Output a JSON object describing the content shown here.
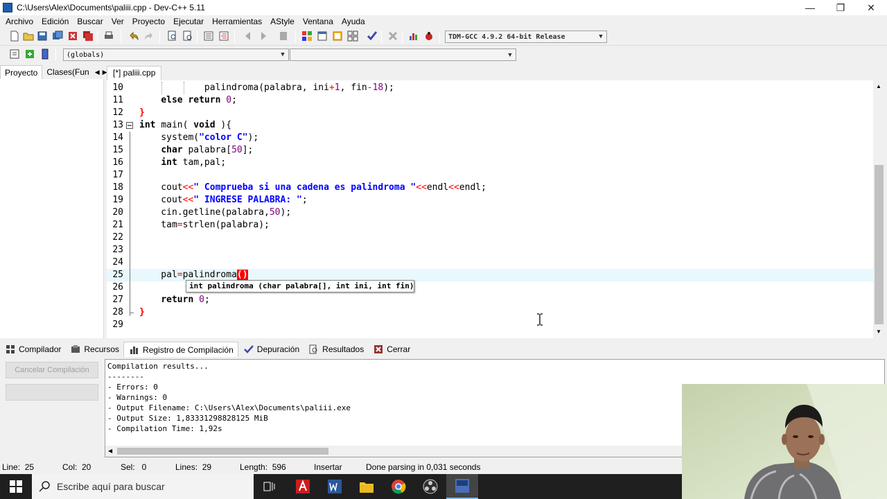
{
  "window": {
    "title": "C:\\Users\\Alex\\Documents\\paliii.cpp - Dev-C++ 5.11",
    "minimize": "—",
    "restore": "❐",
    "close": "✕"
  },
  "menu": [
    "Archivo",
    "Edición",
    "Buscar",
    "Ver",
    "Proyecto",
    "Ejecutar",
    "Herramientas",
    "AStyle",
    "Ventana",
    "Ayuda"
  ],
  "toolbar": {
    "compiler": "TDM-GCC 4.9.2 64-bit Release",
    "scope": "(globals)",
    "function": ""
  },
  "left_tabs": [
    "Proyecto",
    "Clases(Fun"
  ],
  "editor_tab": "[*] paliii.cpp",
  "code_lines": [
    {
      "n": "10",
      "fold": "",
      "segs": [
        [
          "",
          "            "
        ],
        [
          "kw",
          ""
        ],
        [
          "",
          "palindroma(palabra, ini"
        ],
        [
          "op",
          "+"
        ],
        [
          "num",
          "1"
        ],
        [
          "",
          ", fin"
        ],
        [
          "op",
          "-"
        ],
        [
          "num",
          "18"
        ],
        [
          "",
          ");"
        ]
      ]
    },
    {
      "n": "11",
      "fold": "",
      "segs": [
        [
          "",
          "    "
        ],
        [
          "kw",
          "else return "
        ],
        [
          "num",
          "0"
        ],
        [
          "",
          ";"
        ]
      ]
    },
    {
      "n": "12",
      "fold": "",
      "segs": [
        [
          "br",
          "}"
        ]
      ]
    },
    {
      "n": "13",
      "fold": "minus",
      "segs": [
        [
          "kw",
          "int "
        ],
        [
          "",
          "main( "
        ],
        [
          "kw",
          "void "
        ],
        [
          "",
          "){"
        ]
      ]
    },
    {
      "n": "14",
      "fold": "",
      "segs": [
        [
          "",
          "    system("
        ],
        [
          "str",
          "\"color C\""
        ],
        [
          "",
          ");"
        ]
      ]
    },
    {
      "n": "15",
      "fold": "",
      "segs": [
        [
          "",
          "    "
        ],
        [
          "kw",
          "char "
        ],
        [
          "",
          "palabra["
        ],
        [
          "num",
          "50"
        ],
        [
          "",
          "];"
        ]
      ]
    },
    {
      "n": "16",
      "fold": "",
      "segs": [
        [
          "",
          "    "
        ],
        [
          "kw",
          "int "
        ],
        [
          "",
          "tam,pal;"
        ]
      ]
    },
    {
      "n": "17",
      "fold": "",
      "segs": [
        [
          "",
          ""
        ]
      ]
    },
    {
      "n": "18",
      "fold": "",
      "segs": [
        [
          "",
          "    cout"
        ],
        [
          "op",
          "<<"
        ],
        [
          "str",
          "\" Comprueba si una cadena es palindroma \""
        ],
        [
          "op",
          "<<"
        ],
        [
          "",
          "endl"
        ],
        [
          "op",
          "<<"
        ],
        [
          "",
          "endl;"
        ]
      ]
    },
    {
      "n": "19",
      "fold": "",
      "segs": [
        [
          "",
          "    cout"
        ],
        [
          "op",
          "<<"
        ],
        [
          "str",
          "\" INGRESE PALABRA: \""
        ],
        [
          "",
          ";"
        ]
      ]
    },
    {
      "n": "20",
      "fold": "",
      "segs": [
        [
          "",
          "    cin.getline(palabra,"
        ],
        [
          "num",
          "50"
        ],
        [
          "",
          ");"
        ]
      ]
    },
    {
      "n": "21",
      "fold": "",
      "segs": [
        [
          "",
          "    tam"
        ],
        [
          "op",
          "="
        ],
        [
          "",
          "strlen(palabra);"
        ]
      ]
    },
    {
      "n": "22",
      "fold": "",
      "segs": [
        [
          "",
          ""
        ]
      ]
    },
    {
      "n": "23",
      "fold": "",
      "segs": [
        [
          "",
          ""
        ]
      ]
    },
    {
      "n": "24",
      "fold": "",
      "segs": [
        [
          "",
          ""
        ]
      ]
    },
    {
      "n": "25",
      "fold": "",
      "segs": [
        [
          "",
          "    pal"
        ],
        [
          "op",
          "="
        ],
        [
          "",
          "palindroma"
        ],
        [
          "bracematch",
          "()"
        ]
      ]
    },
    {
      "n": "26",
      "fold": "",
      "segs": [
        [
          "",
          ""
        ]
      ]
    },
    {
      "n": "27",
      "fold": "",
      "segs": [
        [
          "",
          "    "
        ],
        [
          "kw",
          "return "
        ],
        [
          "num",
          "0"
        ],
        [
          "",
          ";"
        ]
      ]
    },
    {
      "n": "28",
      "fold": "",
      "segs": [
        [
          "br",
          "}"
        ]
      ]
    },
    {
      "n": "29",
      "fold": "",
      "segs": [
        [
          "",
          ""
        ]
      ]
    }
  ],
  "tooltip": {
    "ret": "int palindroma ",
    "params": "(char palabra[], int ini, int fin)"
  },
  "bottom_tabs": [
    "Compilador",
    "Recursos",
    "Registro de Compilación",
    "Depuración",
    "Resultados",
    "Cerrar"
  ],
  "bottom_buttons": {
    "cancel": "Cancelar Compilación",
    "blank": ""
  },
  "output_lines": [
    "Compilation results...",
    "--------",
    "- Errors: 0",
    "- Warnings: 0",
    "- Output Filename: C:\\Users\\Alex\\Documents\\paliii.exe",
    "- Output Size: 1,83331298828125 MiB",
    "- Compilation Time: 1,92s"
  ],
  "status": {
    "line": "Line:  25",
    "col": "Col:  20",
    "sel": "Sel:   0",
    "lines": "Lines:  29",
    "length": "Length:  596",
    "mode": "Insertar",
    "message": "Done parsing in 0,031 seconds"
  },
  "taskbar": {
    "search_placeholder": "Escribe aquí para buscar"
  }
}
